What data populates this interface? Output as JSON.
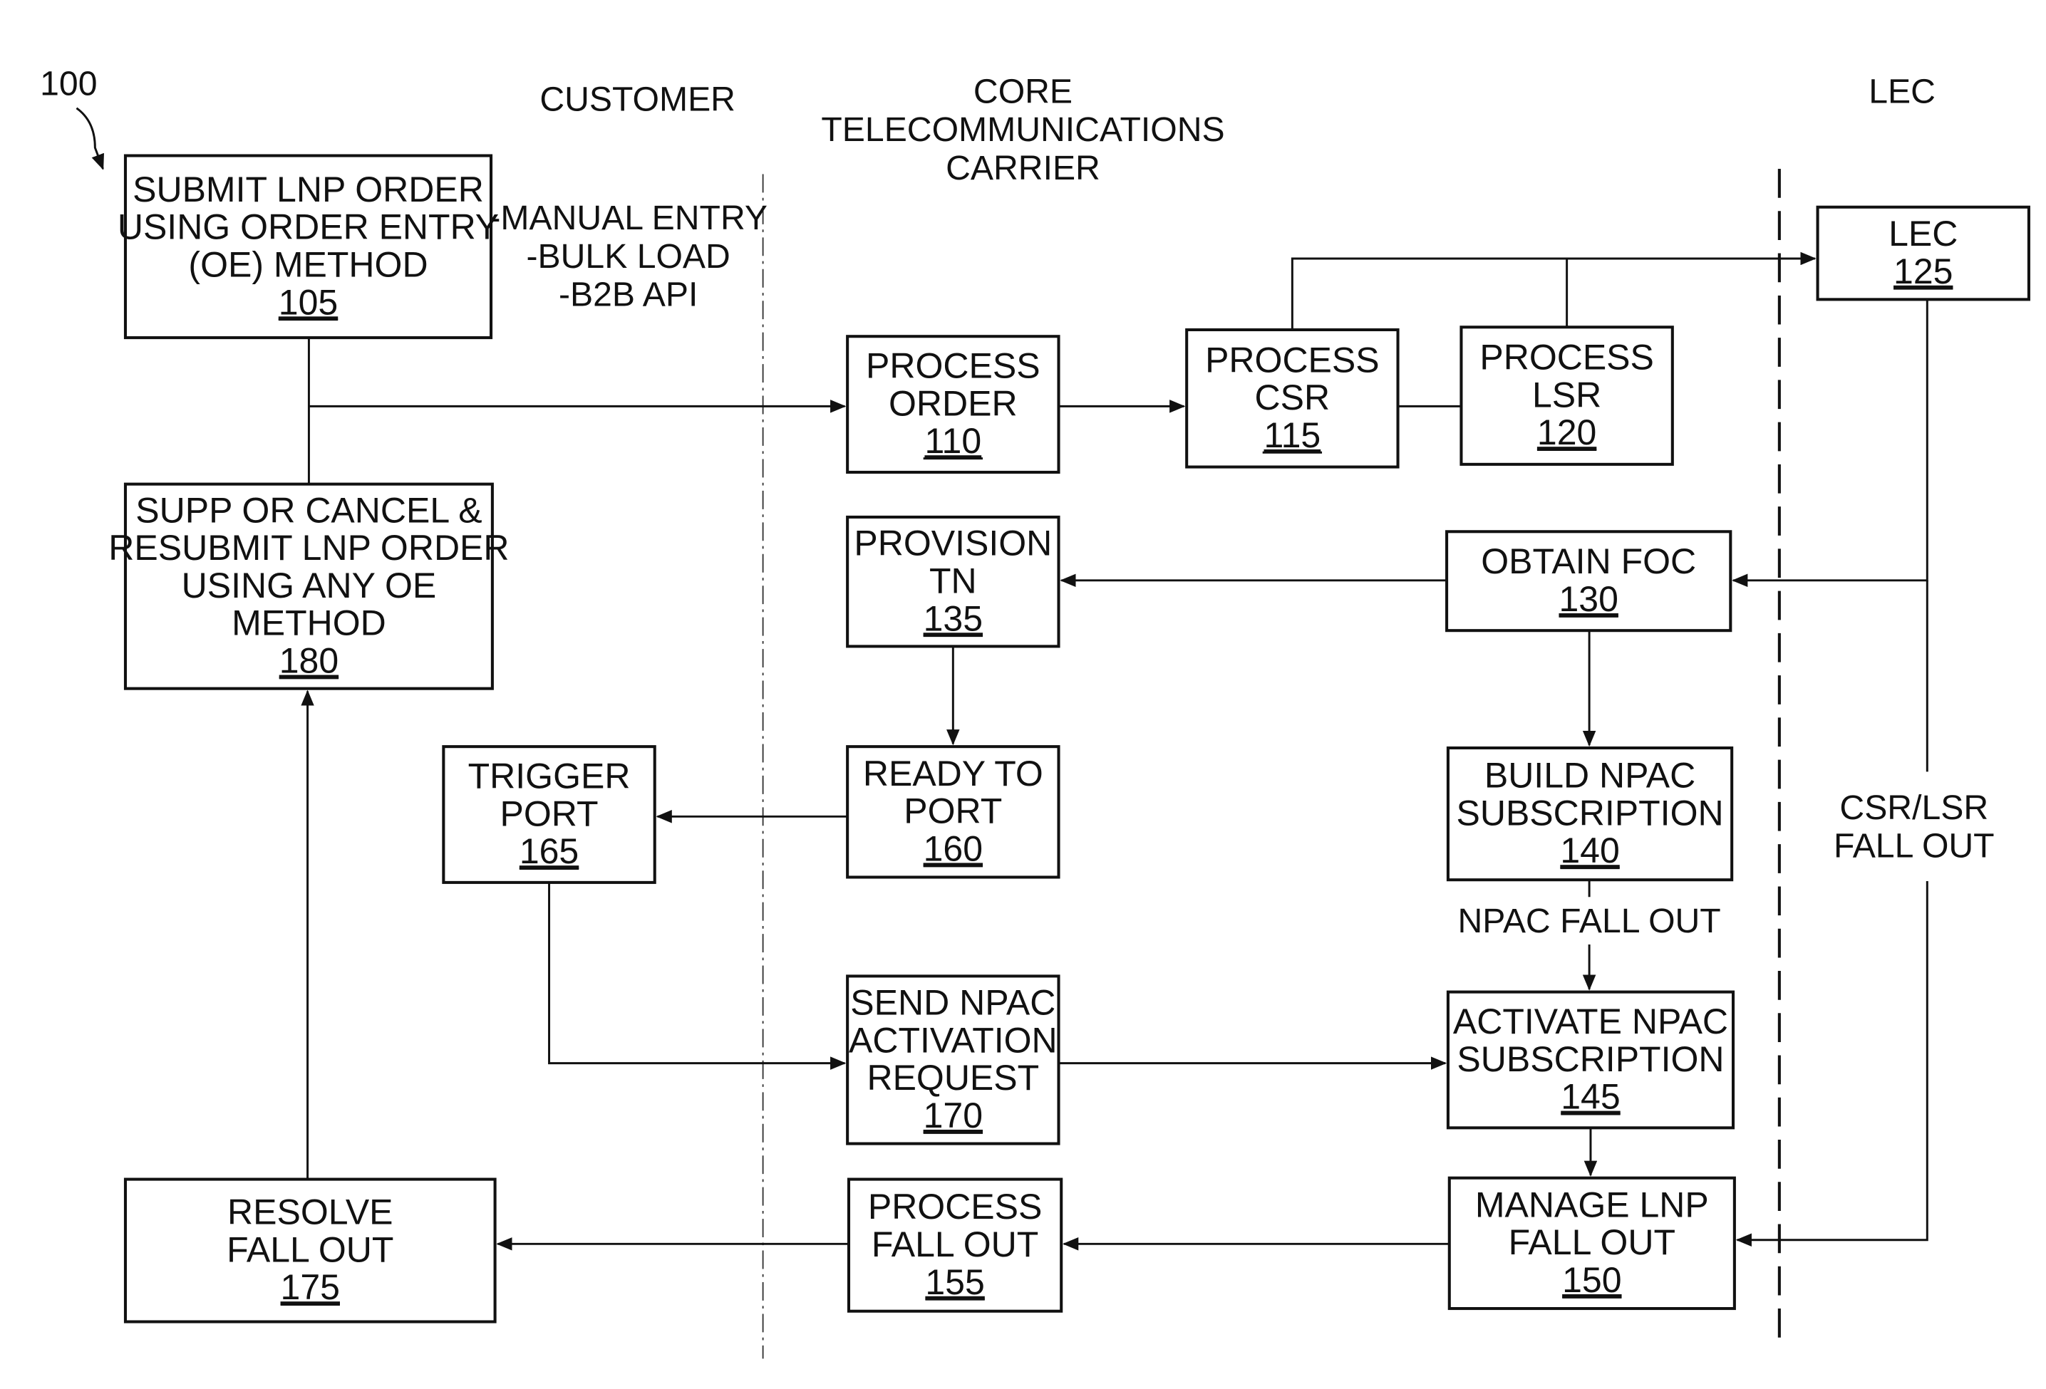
{
  "figure": {
    "reference_number": "100"
  },
  "lanes": {
    "customer": "CUSTOMER",
    "core_carrier": [
      "CORE",
      "TELECOMMUNICATIONS",
      "CARRIER"
    ],
    "lec": "LEC"
  },
  "order_entry_methods": [
    "-MANUAL ENTRY",
    "-BULK LOAD",
    "-B2B API"
  ],
  "boxes": {
    "b105": {
      "lines": [
        "SUBMIT LNP ORDER",
        "USING ORDER ENTRY",
        "(OE) METHOD"
      ],
      "num": "105"
    },
    "b110": {
      "lines": [
        "PROCESS",
        "ORDER"
      ],
      "num": "110"
    },
    "b115": {
      "lines": [
        "PROCESS",
        "CSR"
      ],
      "num": "115"
    },
    "b120": {
      "lines": [
        "PROCESS",
        "LSR"
      ],
      "num": "120"
    },
    "b125": {
      "lines": [
        "LEC"
      ],
      "num": "125"
    },
    "b130": {
      "lines": [
        "OBTAIN FOC"
      ],
      "num": "130"
    },
    "b135": {
      "lines": [
        "PROVISION",
        "TN"
      ],
      "num": "135"
    },
    "b140": {
      "lines": [
        "BUILD NPAC",
        "SUBSCRIPTION"
      ],
      "num": "140"
    },
    "b145": {
      "lines": [
        "ACTIVATE NPAC",
        "SUBSCRIPTION"
      ],
      "num": "145"
    },
    "b150": {
      "lines": [
        "MANAGE LNP",
        "FALL OUT"
      ],
      "num": "150"
    },
    "b155": {
      "lines": [
        "PROCESS",
        "FALL OUT"
      ],
      "num": "155"
    },
    "b160": {
      "lines": [
        "READY TO",
        "PORT"
      ],
      "num": "160"
    },
    "b165": {
      "lines": [
        "TRIGGER",
        "PORT"
      ],
      "num": "165"
    },
    "b170": {
      "lines": [
        "SEND NPAC",
        "ACTIVATION",
        "REQUEST"
      ],
      "num": "170"
    },
    "b175": {
      "lines": [
        "RESOLVE",
        "FALL OUT"
      ],
      "num": "175"
    },
    "b180": {
      "lines": [
        "SUPP OR CANCEL &",
        "RESUBMIT LNP ORDER",
        "USING ANY OE",
        "METHOD"
      ],
      "num": "180"
    }
  },
  "edge_labels": {
    "npac_fall_out": "NPAC FALL OUT",
    "csr_lsr_fall_out": [
      "CSR/LSR",
      "FALL OUT"
    ]
  }
}
